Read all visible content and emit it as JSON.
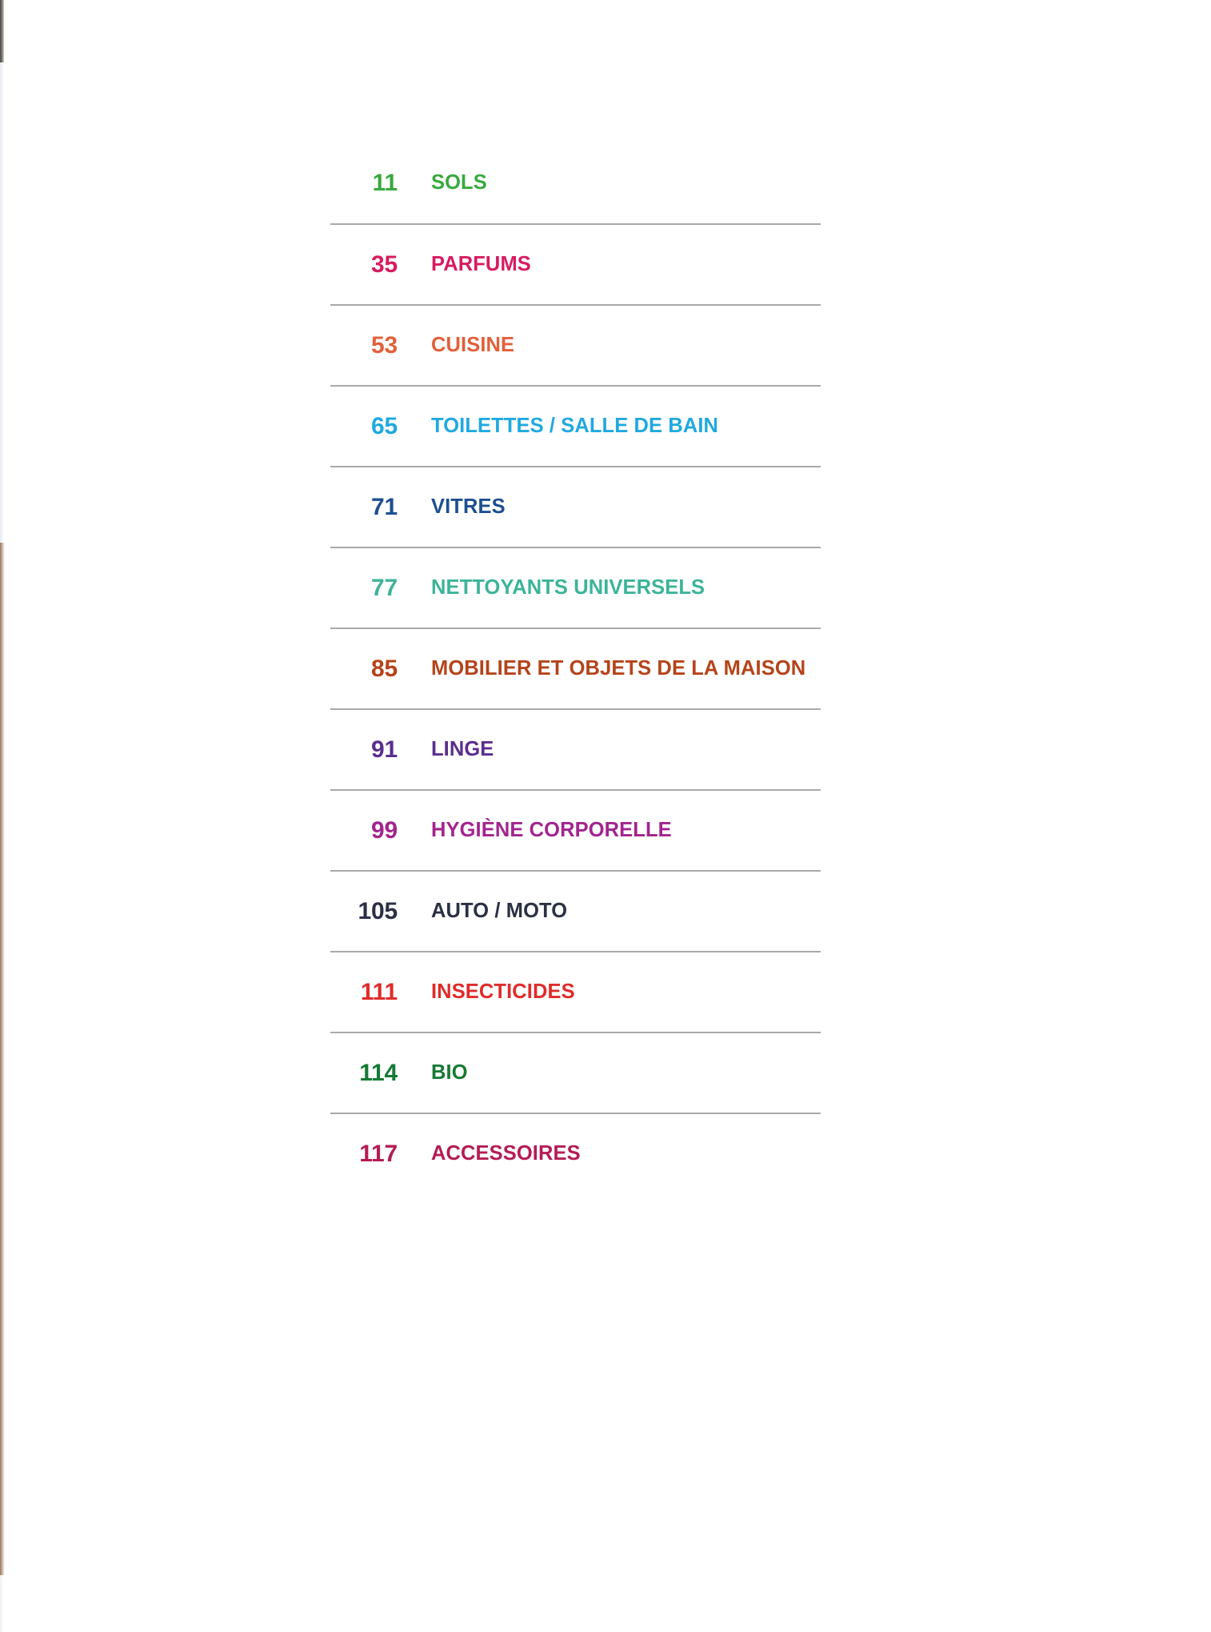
{
  "document": {
    "type": "table-of-contents",
    "language": "fr"
  },
  "toc": {
    "entries": [
      {
        "page": "11",
        "title": "SOLS",
        "color": "#3aa93f"
      },
      {
        "page": "35",
        "title": "PARFUMS",
        "color": "#d81b60"
      },
      {
        "page": "53",
        "title": "CUISINE",
        "color": "#e2603a"
      },
      {
        "page": "65",
        "title": "TOILETTES / SALLE DE BAIN",
        "color": "#1fa9e0"
      },
      {
        "page": "71",
        "title": "VITRES",
        "color": "#1d4f91"
      },
      {
        "page": "77",
        "title": "NETTOYANTS UNIVERSELS",
        "color": "#3cb499"
      },
      {
        "page": "85",
        "title": "MOBILIER ET OBJETS DE LA MAISON",
        "color": "#b5441a"
      },
      {
        "page": "91",
        "title": "LINGE",
        "color": "#5b2d8e"
      },
      {
        "page": "99",
        "title": "HYGIÈNE CORPORELLE",
        "color": "#a2248f"
      },
      {
        "page": "105",
        "title": "AUTO / MOTO",
        "color": "#2b3044"
      },
      {
        "page": "111",
        "title": "INSECTICIDES",
        "color": "#e02b2b"
      },
      {
        "page": "114",
        "title": "BIO",
        "color": "#157a33"
      },
      {
        "page": "117",
        "title": "ACCESSOIRES",
        "color": "#b41c55"
      }
    ]
  },
  "style": {
    "background": "#ffffff",
    "rule_color": "#a9a9a9"
  }
}
